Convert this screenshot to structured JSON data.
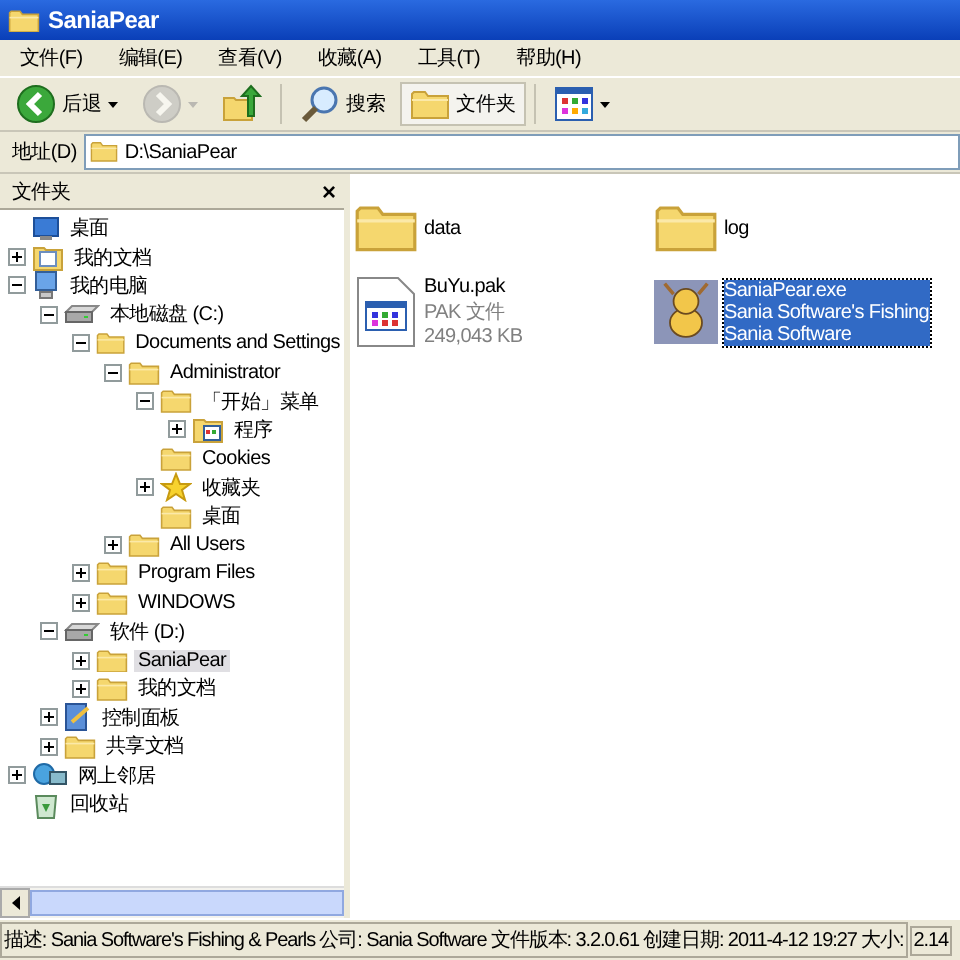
{
  "window": {
    "title": "SaniaPear"
  },
  "menu": [
    "文件(F)",
    "编辑(E)",
    "查看(V)",
    "收藏(A)",
    "工具(T)",
    "帮助(H)"
  ],
  "toolbar": [
    {
      "kind": "back",
      "label": "后退",
      "disabled": false,
      "selected": false
    },
    {
      "kind": "forward",
      "disabled": true,
      "selected": false
    },
    {
      "kind": "up",
      "disabled": false,
      "selected": false
    },
    {
      "kind": "search",
      "label": "搜索",
      "disabled": false,
      "selected": false
    },
    {
      "kind": "folders",
      "label": "文件夹",
      "disabled": false,
      "selected": true
    },
    {
      "kind": "views",
      "disabled": false,
      "selected": false
    }
  ],
  "address": {
    "label": "地址(D)",
    "value": "D:\\SaniaPear"
  },
  "folders_pane": {
    "title": "文件夹",
    "close": "×",
    "tree": [
      {
        "label": "桌面",
        "kind": "desktop",
        "selected": false,
        "children": [
          {
            "label": "我的文档",
            "kind": "documents",
            "expandable": true,
            "expanded": false,
            "selected": false
          },
          {
            "label": "我的电脑",
            "kind": "computer",
            "expandable": true,
            "expanded": true,
            "selected": false,
            "children": [
              {
                "label": "本地磁盘 (C:)",
                "kind": "drive",
                "expandable": true,
                "expanded": true,
                "selected": false,
                "children": [
                  {
                    "label": "Documents and Settings",
                    "kind": "folder",
                    "expandable": true,
                    "expanded": true,
                    "selected": false,
                    "children": [
                      {
                        "label": "Administrator",
                        "kind": "folder",
                        "expandable": true,
                        "expanded": true,
                        "selected": false,
                        "children": [
                          {
                            "label": "「开始」菜单",
                            "kind": "folder",
                            "expandable": true,
                            "expanded": true,
                            "selected": false,
                            "children": [
                              {
                                "label": "程序",
                                "kind": "programs",
                                "expandable": true,
                                "expanded": false,
                                "selected": false
                              }
                            ]
                          },
                          {
                            "label": "Cookies",
                            "kind": "folder",
                            "selected": false
                          },
                          {
                            "label": "收藏夹",
                            "kind": "favorites",
                            "expandable": true,
                            "expanded": false,
                            "selected": false
                          },
                          {
                            "label": "桌面",
                            "kind": "folder",
                            "selected": false
                          }
                        ]
                      },
                      {
                        "label": "All Users",
                        "kind": "folder",
                        "expandable": true,
                        "expanded": false,
                        "selected": false
                      }
                    ]
                  },
                  {
                    "label": "Program Files",
                    "kind": "folder",
                    "expandable": true,
                    "expanded": false,
                    "selected": false
                  },
                  {
                    "label": "WINDOWS",
                    "kind": "folder",
                    "expandable": true,
                    "expanded": false,
                    "selected": false
                  }
                ]
              },
              {
                "label": "软件 (D:)",
                "kind": "drive",
                "expandable": true,
                "expanded": true,
                "selected": false,
                "children": [
                  {
                    "label": "SaniaPear",
                    "kind": "folder",
                    "expandable": true,
                    "expanded": false,
                    "selected": true
                  },
                  {
                    "label": "我的文档",
                    "kind": "folder",
                    "expandable": true,
                    "expanded": false,
                    "selected": false
                  }
                ]
              },
              {
                "label": "控制面板",
                "kind": "control-panel",
                "expandable": true,
                "expanded": false,
                "selected": false
              },
              {
                "label": "共享文档",
                "kind": "folder",
                "expandable": true,
                "expanded": false,
                "selected": false
              }
            ]
          },
          {
            "label": "网上邻居",
            "kind": "network",
            "expandable": true,
            "expanded": false,
            "selected": false
          },
          {
            "label": "回收站",
            "kind": "recycle",
            "selected": false
          }
        ]
      }
    ]
  },
  "files": [
    {
      "kind": "folder",
      "name": "data",
      "selected": false
    },
    {
      "kind": "folder",
      "name": "log",
      "selected": false
    },
    {
      "kind": "pak",
      "name": "BuYu.pak",
      "details": [
        "PAK 文件",
        "249,043 KB"
      ],
      "selected": false
    },
    {
      "kind": "exe",
      "name": "SaniaPear.exe",
      "details": [
        "Sania Software's Fishing",
        "Sania Software"
      ],
      "selected": true
    }
  ],
  "status_bar": [
    "描述: Sania Software's Fishing & Pearls 公司: Sania Software 文件版本: 3.2.0.61 创建日期: 2011-4-12 19:27 大小:",
    "2.14"
  ]
}
